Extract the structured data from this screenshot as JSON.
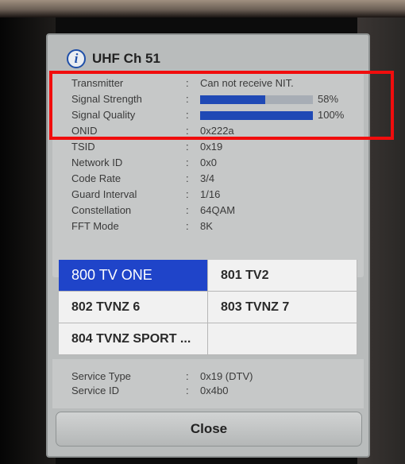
{
  "dialog": {
    "title": "UHF Ch 51",
    "icon": "info-icon"
  },
  "info": [
    {
      "label": "Transmitter",
      "value": "Can not receive NIT."
    },
    {
      "label": "Signal Strength",
      "bar_fraction": 0.58,
      "value": "58%"
    },
    {
      "label": "Signal Quality",
      "bar_fraction": 1.0,
      "value": "100%"
    },
    {
      "label": "ONID",
      "value": "0x222a"
    },
    {
      "label": "TSID",
      "value": "0x19"
    },
    {
      "label": "Network ID",
      "value": "0x0"
    },
    {
      "label": "Code Rate",
      "value": "3/4"
    },
    {
      "label": "Guard Interval",
      "value": "1/16"
    },
    {
      "label": "Constellation",
      "value": "64QAM"
    },
    {
      "label": "FFT Mode",
      "value": "8K"
    }
  ],
  "separator": ":",
  "channels": [
    {
      "label": "800 TV ONE",
      "selected": true
    },
    {
      "label": "801 TV2",
      "selected": false
    },
    {
      "label": "802 TVNZ 6",
      "selected": false
    },
    {
      "label": "803 TVNZ 7",
      "selected": false
    },
    {
      "label": "804 TVNZ SPORT ...",
      "selected": false
    },
    {
      "label": "",
      "selected": false
    }
  ],
  "service": [
    {
      "label": "Service Type",
      "value": "0x19 (DTV)"
    },
    {
      "label": "Service ID",
      "value": "0x4b0"
    }
  ],
  "close_label": "Close",
  "colors": {
    "bar": "#1f49b5",
    "selected_channel": "#1f44c9",
    "highlight_box": "#f00d0d"
  }
}
